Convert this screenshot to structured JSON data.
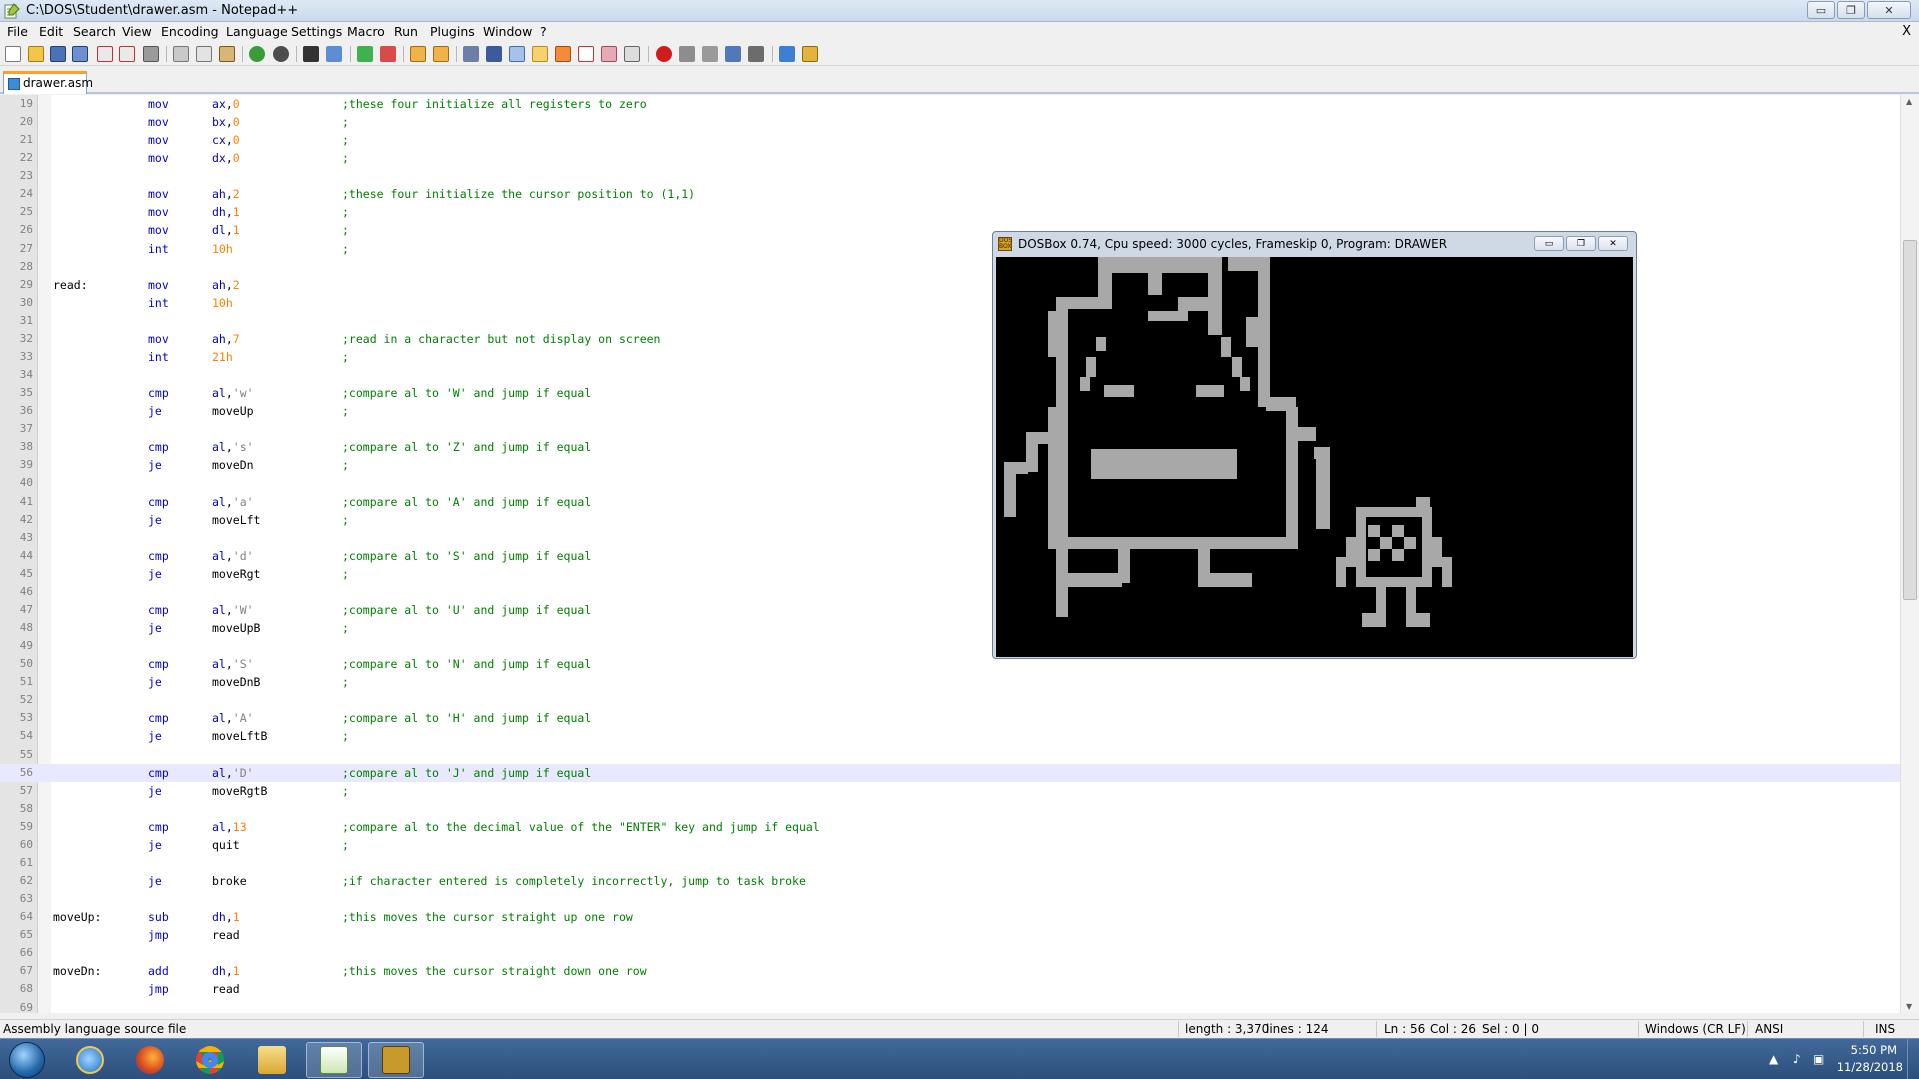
{
  "window": {
    "title": "C:\\DOS\\Student\\drawer.asm - Notepad++",
    "buttons": {
      "minimize": "▭",
      "restore": "❐",
      "close": "✕"
    }
  },
  "menu": [
    "File",
    "Edit",
    "Search",
    "View",
    "Encoding",
    "Language",
    "Settings",
    "Macro",
    "Run",
    "Plugins",
    "Window",
    "?"
  ],
  "menu_close": "X",
  "tab": {
    "label": "drawer.asm"
  },
  "code": [
    {
      "n": "19",
      "kw": "mov",
      "op": [
        [
          "reg",
          "ax"
        ],
        [
          "plain",
          ","
        ],
        [
          "num",
          "0"
        ]
      ],
      "cmt": ";these four initialize all registers to zero"
    },
    {
      "n": "20",
      "kw": "mov",
      "op": [
        [
          "reg",
          "bx"
        ],
        [
          "plain",
          ","
        ],
        [
          "num",
          "0"
        ]
      ],
      "cmt": ";"
    },
    {
      "n": "21",
      "kw": "mov",
      "op": [
        [
          "reg",
          "cx"
        ],
        [
          "plain",
          ","
        ],
        [
          "num",
          "0"
        ]
      ],
      "cmt": ";"
    },
    {
      "n": "22",
      "kw": "mov",
      "op": [
        [
          "reg",
          "dx"
        ],
        [
          "plain",
          ","
        ],
        [
          "num",
          "0"
        ]
      ],
      "cmt": ";"
    },
    {
      "n": "23"
    },
    {
      "n": "24",
      "kw": "mov",
      "op": [
        [
          "reg",
          "ah"
        ],
        [
          "plain",
          ","
        ],
        [
          "num",
          "2"
        ]
      ],
      "cmt": ";these four initialize the cursor position to (1,1)"
    },
    {
      "n": "25",
      "kw": "mov",
      "op": [
        [
          "reg",
          "dh"
        ],
        [
          "plain",
          ","
        ],
        [
          "num",
          "1"
        ]
      ],
      "cmt": ";"
    },
    {
      "n": "26",
      "kw": "mov",
      "op": [
        [
          "reg",
          "dl"
        ],
        [
          "plain",
          ","
        ],
        [
          "num",
          "1"
        ]
      ],
      "cmt": ";"
    },
    {
      "n": "27",
      "kw": "int",
      "op": [
        [
          "num",
          "10h"
        ]
      ],
      "cmt": ";"
    },
    {
      "n": "28"
    },
    {
      "n": "29",
      "lbl": "read:",
      "kw": "mov",
      "op": [
        [
          "reg",
          "ah"
        ],
        [
          "plain",
          ","
        ],
        [
          "num",
          "2"
        ]
      ]
    },
    {
      "n": "30",
      "kw": "int",
      "op": [
        [
          "num",
          "10h"
        ]
      ]
    },
    {
      "n": "31"
    },
    {
      "n": "32",
      "kw": "mov",
      "op": [
        [
          "reg",
          "ah"
        ],
        [
          "plain",
          ","
        ],
        [
          "num",
          "7"
        ]
      ],
      "cmt": ";read in a character but not display on screen"
    },
    {
      "n": "33",
      "kw": "int",
      "op": [
        [
          "num",
          "21h"
        ]
      ],
      "cmt": ";"
    },
    {
      "n": "34"
    },
    {
      "n": "35",
      "kw": "cmp",
      "op": [
        [
          "reg",
          "al"
        ],
        [
          "plain",
          ","
        ],
        [
          "str",
          "'w'"
        ]
      ],
      "cmt": ";compare al to 'W' and jump if equal"
    },
    {
      "n": "36",
      "kw": "je",
      "op": [
        [
          "plain",
          "moveUp"
        ]
      ],
      "cmt": ";"
    },
    {
      "n": "37"
    },
    {
      "n": "38",
      "kw": "cmp",
      "op": [
        [
          "reg",
          "al"
        ],
        [
          "plain",
          ","
        ],
        [
          "str",
          "'s'"
        ]
      ],
      "cmt": ";compare al to 'Z' and jump if equal"
    },
    {
      "n": "39",
      "kw": "je",
      "op": [
        [
          "plain",
          "moveDn"
        ]
      ],
      "cmt": ";"
    },
    {
      "n": "40"
    },
    {
      "n": "41",
      "kw": "cmp",
      "op": [
        [
          "reg",
          "al"
        ],
        [
          "plain",
          ","
        ],
        [
          "str",
          "'a'"
        ]
      ],
      "cmt": ";compare al to 'A' and jump if equal"
    },
    {
      "n": "42",
      "kw": "je",
      "op": [
        [
          "plain",
          "moveLft"
        ]
      ],
      "cmt": ";"
    },
    {
      "n": "43"
    },
    {
      "n": "44",
      "kw": "cmp",
      "op": [
        [
          "reg",
          "al"
        ],
        [
          "plain",
          ","
        ],
        [
          "str",
          "'d'"
        ]
      ],
      "cmt": ";compare al to 'S' and jump if equal"
    },
    {
      "n": "45",
      "kw": "je",
      "op": [
        [
          "plain",
          "moveRgt"
        ]
      ],
      "cmt": ";"
    },
    {
      "n": "46"
    },
    {
      "n": "47",
      "kw": "cmp",
      "op": [
        [
          "reg",
          "al"
        ],
        [
          "plain",
          ","
        ],
        [
          "str",
          "'W'"
        ]
      ],
      "cmt": ";compare al to 'U' and jump if equal"
    },
    {
      "n": "48",
      "kw": "je",
      "op": [
        [
          "plain",
          "moveUpB"
        ]
      ],
      "cmt": ";"
    },
    {
      "n": "49"
    },
    {
      "n": "50",
      "kw": "cmp",
      "op": [
        [
          "reg",
          "al"
        ],
        [
          "plain",
          ","
        ],
        [
          "str",
          "'S'"
        ]
      ],
      "cmt": ";compare al to 'N' and jump if equal"
    },
    {
      "n": "51",
      "kw": "je",
      "op": [
        [
          "plain",
          "moveDnB"
        ]
      ],
      "cmt": ";"
    },
    {
      "n": "52"
    },
    {
      "n": "53",
      "kw": "cmp",
      "op": [
        [
          "reg",
          "al"
        ],
        [
          "plain",
          ","
        ],
        [
          "str",
          "'A'"
        ]
      ],
      "cmt": ";compare al to 'H' and jump if equal"
    },
    {
      "n": "54",
      "kw": "je",
      "op": [
        [
          "plain",
          "moveLftB"
        ]
      ],
      "cmt": ";"
    },
    {
      "n": "55"
    },
    {
      "n": "56",
      "kw": "cmp",
      "op": [
        [
          "reg",
          "al"
        ],
        [
          "plain",
          ","
        ],
        [
          "str",
          "'D'"
        ]
      ],
      "cmt": ";compare al to 'J' and jump if equal",
      "current": true
    },
    {
      "n": "57",
      "kw": "je",
      "op": [
        [
          "plain",
          "moveRgtB"
        ]
      ],
      "cmt": ";"
    },
    {
      "n": "58"
    },
    {
      "n": "59",
      "kw": "cmp",
      "op": [
        [
          "reg",
          "al"
        ],
        [
          "plain",
          ","
        ],
        [
          "num",
          "13"
        ]
      ],
      "cmt": ";compare al to the decimal value of the \"ENTER\" key and jump if equal"
    },
    {
      "n": "60",
      "kw": "je",
      "op": [
        [
          "plain",
          "quit"
        ]
      ],
      "cmt": ";"
    },
    {
      "n": "61"
    },
    {
      "n": "62",
      "kw": "je",
      "op": [
        [
          "plain",
          "broke"
        ]
      ],
      "cmt": ";if character entered is completely incorrectly, jump to task broke"
    },
    {
      "n": "63"
    },
    {
      "n": "64",
      "lbl": "moveUp:",
      "kw": "sub",
      "op": [
        [
          "reg",
          "dh"
        ],
        [
          "plain",
          ","
        ],
        [
          "num",
          "1"
        ]
      ],
      "cmt": ";this moves the cursor straight up one row"
    },
    {
      "n": "65",
      "kw": "jmp",
      "op": [
        [
          "plain",
          "read"
        ]
      ]
    },
    {
      "n": "66"
    },
    {
      "n": "67",
      "lbl": "moveDn:",
      "kw": "add",
      "op": [
        [
          "reg",
          "dh"
        ],
        [
          "plain",
          ","
        ],
        [
          "num",
          "1"
        ]
      ],
      "cmt": ";this moves the cursor straight down one row"
    },
    {
      "n": "68",
      "kw": "jmp",
      "op": [
        [
          "plain",
          "read"
        ]
      ]
    },
    {
      "n": "69"
    }
  ],
  "status": {
    "filetype": "Assembly language source file",
    "length": "length : 3,370",
    "lines": "lines : 124",
    "ln": "Ln : 56",
    "col": "Col : 26",
    "sel": "Sel : 0 | 0",
    "eol": "Windows (CR LF)",
    "encoding": "ANSI",
    "mode": "INS"
  },
  "dosbox": {
    "title": "DOSBox 0.74, Cpu speed:    3000 cycles, Frameskip  0, Program:   DRAWER",
    "icon_text": "DOS BOX",
    "buttons": {
      "minimize": "▭",
      "restore": "❐",
      "close": "✕"
    }
  },
  "tray": {
    "time": "5:50 PM",
    "date": "11/28/2018"
  },
  "colors": {
    "keyword": "#0000e0",
    "register": "#0000c0",
    "number": "#ff8000",
    "comment": "#008000",
    "current_line": "#e8e8ff"
  }
}
